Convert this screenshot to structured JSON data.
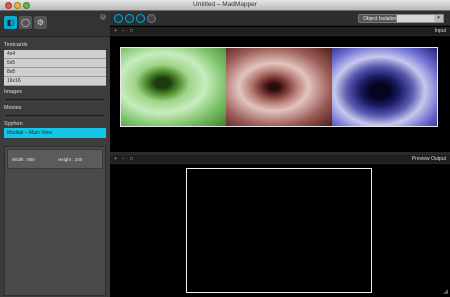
{
  "window": {
    "title": "Untitled – MadMapper"
  },
  "left": {
    "testcards_heading": "Testcards",
    "testcards": [
      "4x4",
      "5x5",
      "8x8",
      "16x16"
    ],
    "images_heading": "Images",
    "movies_heading": "Movies",
    "syphon_heading": "Syphon",
    "syphon_selected": "Madlab – Main View",
    "width_label": "Width : 800",
    "height_label": "Height : 240"
  },
  "toolbar": {
    "object_isolation_label": "Object Isolation",
    "object_isolation_value": ""
  },
  "input": {
    "label": "Input"
  },
  "output": {
    "label": "Preview Output"
  },
  "icons": {
    "surfaces": "surfaces-icon",
    "modes": "modes-icon",
    "settings": "gear-icon"
  }
}
